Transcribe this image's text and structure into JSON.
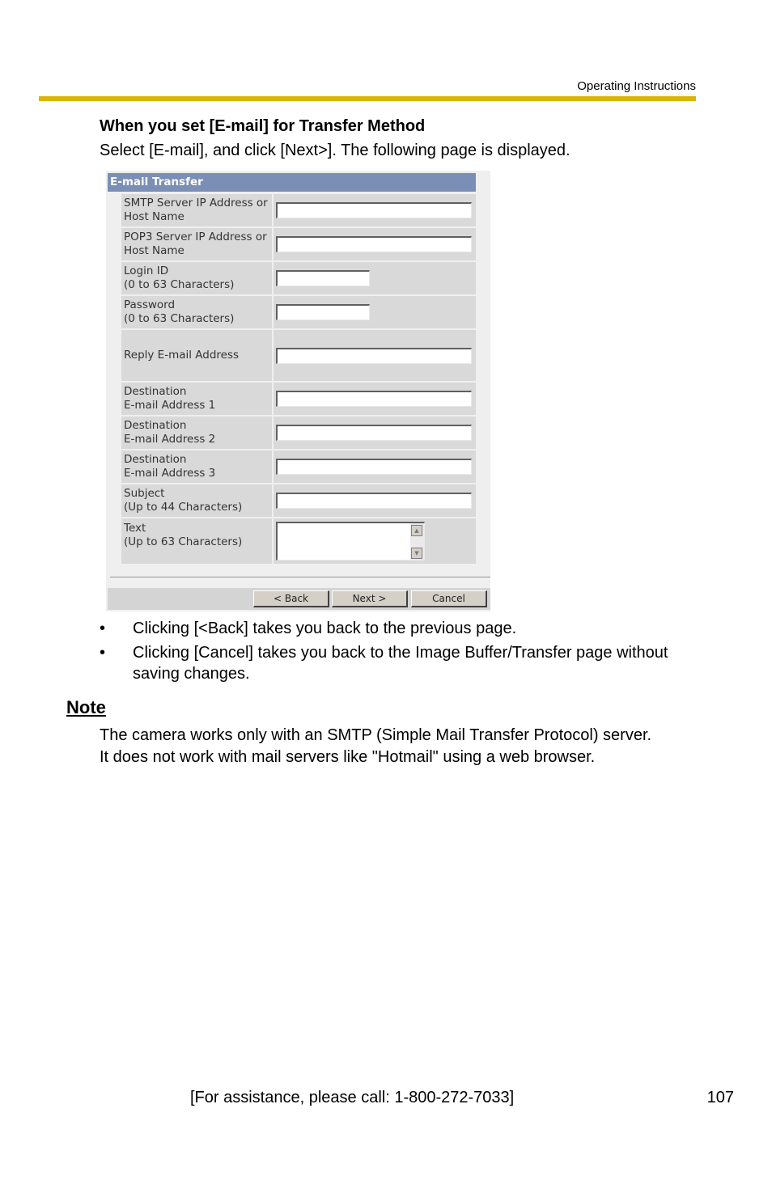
{
  "header": {
    "label": "Operating Instructions"
  },
  "section": {
    "title": "When you set [E-mail] for Transfer Method",
    "intro": "Select [E-mail], and click [Next>]. The following page is displayed."
  },
  "screenshot": {
    "title": "E-mail Transfer",
    "fields": [
      {
        "line1": "SMTP Server IP Address or",
        "line2": "Host Name",
        "value": ""
      },
      {
        "line1": "POP3 Server IP Address or",
        "line2": "Host Name",
        "value": ""
      },
      {
        "line1": "Login ID",
        "line2": "(0 to 63 Characters)",
        "value": ""
      },
      {
        "line1": "Password",
        "line2": "(0 to 63 Characters)",
        "value": ""
      },
      {
        "line1": "Reply E-mail Address",
        "line2": "",
        "value": ""
      },
      {
        "line1": "Destination",
        "line2": "E-mail Address 1",
        "value": ""
      },
      {
        "line1": "Destination",
        "line2": "E-mail Address 2",
        "value": ""
      },
      {
        "line1": "Destination",
        "line2": "E-mail Address 3",
        "value": ""
      },
      {
        "line1": "Subject",
        "line2": "(Up to 44 Characters)",
        "value": ""
      },
      {
        "line1": "Text",
        "line2": "(Up to 63 Characters)",
        "value": ""
      }
    ],
    "buttons": {
      "back": "< Back",
      "next": "Next >",
      "cancel": "Cancel"
    },
    "colors": {
      "title_bar": "#7b8fb6",
      "cell": "#d9d9d9"
    }
  },
  "bullets": [
    "Clicking [<Back] takes you back to the previous page.",
    "Clicking [Cancel] takes you back to the Image Buffer/Transfer page without saving changes."
  ],
  "note": {
    "heading": "Note",
    "line1": "The camera works only with an SMTP (Simple Mail Transfer Protocol) server.",
    "line2": "It does not work with mail servers like \"Hotmail\" using a web browser."
  },
  "footer": {
    "assistance": "[For assistance, please call: 1-800-272-7033]",
    "page_number": "107"
  },
  "colors": {
    "header_rule": "#d9b400"
  }
}
